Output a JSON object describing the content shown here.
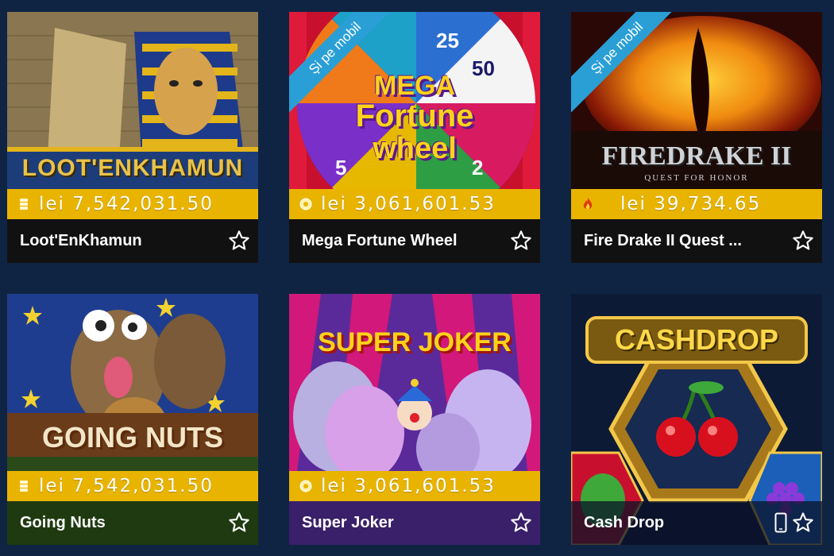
{
  "currency": "lei",
  "games": [
    {
      "title": "Loot'EnKhamun",
      "jackpot": "lei 7,542,031.50",
      "jackpot_icon": "coins-icon",
      "logo": "LOOT'ENKHAMUN"
    },
    {
      "title": "Mega Fortune Wheel",
      "jackpot": "lei 3,061,601.53",
      "jackpot_icon": "coin-sparkle-icon",
      "ribbon": "Și pe mobil",
      "logo_lines": [
        "MEGA",
        "Fortune",
        "wheel"
      ],
      "wheel_numbers": [
        "25",
        "50",
        "2",
        "5"
      ]
    },
    {
      "title": "Fire Drake II Quest ...",
      "jackpot": "lei 39,734.65",
      "jackpot_icon": "flame-icon",
      "ribbon": "Și pe mobil",
      "logo": "FIREDRAKE II",
      "logo_sub": "QUEST FOR HONOR"
    },
    {
      "title": "Going Nuts",
      "jackpot": "lei 7,542,031.50",
      "jackpot_icon": "coins-icon",
      "logo": "GOING NUTS"
    },
    {
      "title": "Super Joker",
      "jackpot": "lei 3,061,601.53",
      "jackpot_icon": "coin-sparkle-icon",
      "logo": "SUPER JOKER"
    },
    {
      "title": "Cash Drop",
      "logo": "CASHDROP",
      "mobile": true
    }
  ],
  "colors": {
    "background": "#0f2443",
    "jackpot_bar": "#e9b400",
    "caption_bar": "#111111",
    "ribbon": "#2a9fd6"
  }
}
